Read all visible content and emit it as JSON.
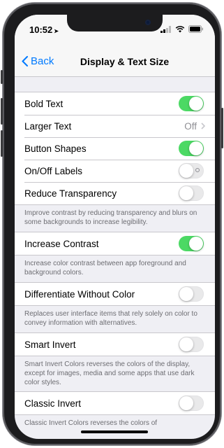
{
  "status": {
    "time": "10:52"
  },
  "nav": {
    "back": "Back",
    "title": "Display & Text Size"
  },
  "settings": {
    "bold_text": "Bold Text",
    "larger_text": "Larger Text",
    "larger_text_value": "Off",
    "button_shapes": "Button Shapes",
    "onoff_labels": "On/Off Labels",
    "reduce_transparency": "Reduce Transparency",
    "reduce_transparency_desc": "Improve contrast by reducing transparency and blurs on some backgrounds to increase legibility.",
    "increase_contrast": "Increase Contrast",
    "increase_contrast_desc": "Increase color contrast between app foreground and background colors.",
    "differentiate": "Differentiate Without Color",
    "differentiate_desc": "Replaces user interface items that rely solely on color to convey information with alternatives.",
    "smart_invert": "Smart Invert",
    "smart_invert_desc": "Smart Invert Colors reverses the colors of the display, except for images, media and some apps that use dark color styles.",
    "classic_invert": "Classic Invert",
    "classic_invert_desc": "Classic Invert Colors reverses the colors of"
  },
  "toggles": {
    "bold_text": true,
    "button_shapes": true,
    "onoff_labels": false,
    "reduce_transparency": false,
    "increase_contrast": true,
    "differentiate": false,
    "smart_invert": false,
    "classic_invert": false
  },
  "colors": {
    "accent": "#007aff",
    "toggle_on": "#4cd964"
  }
}
